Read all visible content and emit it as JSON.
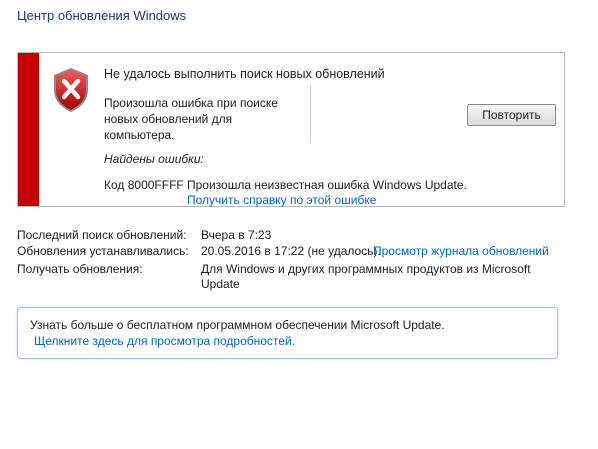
{
  "header": {
    "title": "Центр обновления Windows"
  },
  "error_panel": {
    "heading": "Не удалось выполнить поиск новых обновлений",
    "description": "Произошла ошибка при поиске новых обновлений для компьютера.",
    "retry_label": "Повторить",
    "errors_found_label": "Найдены ошибки:",
    "error_code": "Код 8000FFFF",
    "error_message": "Произошла неизвестная ошибка Windows Update.",
    "help_link": "Получить справку по этой ошибке",
    "stripe_color": "#c40000",
    "icon": "error-shield-icon"
  },
  "status": {
    "last_search_label": "Последний поиск обновлений:",
    "last_search_value": "Вчера в 7:23",
    "installed_label": "Обновления устанавливались:",
    "installed_value": "20.05.2016 в 17:22 (не удалось).",
    "history_link": "Просмотр журнала обновлений",
    "receive_label": "Получать обновления:",
    "receive_value": "Для Windows и других программных продуктов из Microsoft Update"
  },
  "promo": {
    "title": "Узнать больше о бесплатном программном обеспечении Microsoft Update.",
    "link": "Щелкните здесь для просмотра подробностей."
  },
  "colors": {
    "link": "#0066cc",
    "title": "#1e3287",
    "panel_border": "#b9b9b9",
    "promo_border": "#9cc8e6"
  }
}
